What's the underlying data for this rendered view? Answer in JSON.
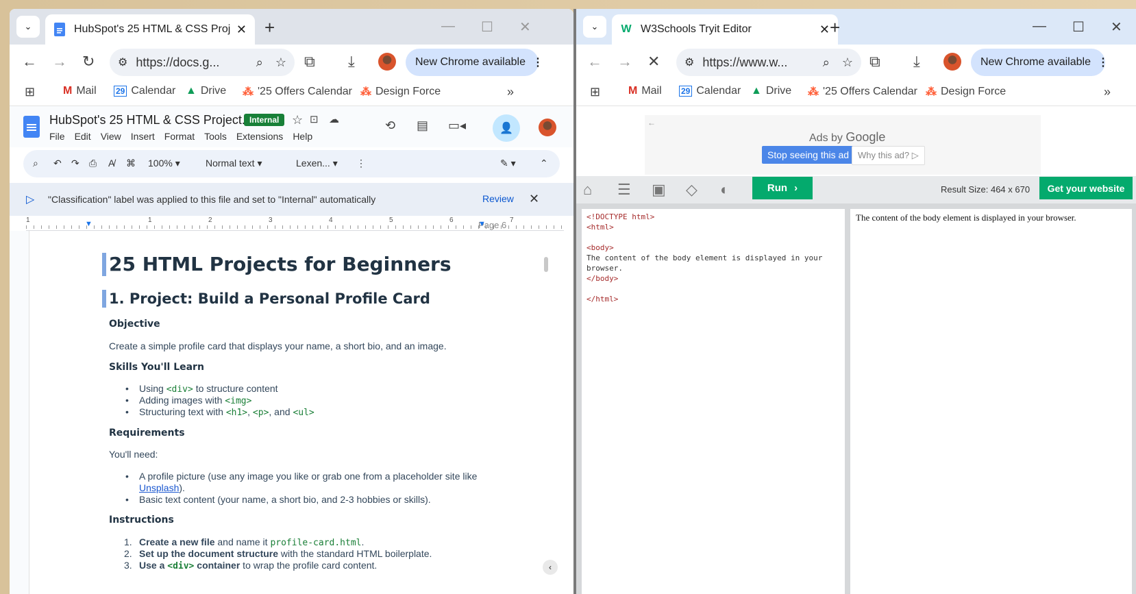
{
  "left_window": {
    "tab_title": "HubSpot's 25 HTML & CSS Proj",
    "url": "https://docs.g...",
    "new_chrome": "New Chrome available",
    "bookmarks": [
      "Mail",
      "Calendar",
      "Drive",
      "'25 Offers Calendar",
      "Design Force"
    ],
    "docs": {
      "title": "HubSpot's 25 HTML & CSS Project...",
      "badge": "Internal",
      "menu": [
        "File",
        "Edit",
        "View",
        "Insert",
        "Format",
        "Tools",
        "Extensions",
        "Help"
      ],
      "zoom": "100%",
      "style": "Normal text",
      "font": "Lexen...",
      "info_message": "\"Classification\" label was applied to this file and set to \"Internal\" automatically",
      "review": "Review",
      "page_label": "Page 6",
      "ruler_numbers": [
        "1",
        "1",
        "2",
        "3",
        "4",
        "5",
        "6",
        "7"
      ],
      "content": {
        "h1": "25 HTML Projects for Beginners",
        "h2": "1. Project: Build a Personal Profile Card",
        "objective_heading": "Objective",
        "objective_text": "Create a simple profile card that displays your name, a short bio, and an image.",
        "skills_heading": "Skills You'll Learn",
        "skill1_pre": "Using ",
        "skill1_code": "<div>",
        "skill1_post": " to structure content",
        "skill2_pre": "Adding images with ",
        "skill2_code": "<img>",
        "skill3_pre": "Structuring text with ",
        "skill3_code1": "<h1>",
        "skill3_sep1": ", ",
        "skill3_code2": "<p>",
        "skill3_sep2": ", and ",
        "skill3_code3": "<ul>",
        "req_heading": "Requirements",
        "req_text": "You'll need:",
        "req1_line1": "A profile picture (use any image you like or grab one from a placeholder site like",
        "req1_link": "Unsplash",
        "req1_end": ").",
        "req2": "Basic text content (your name, a short bio, and 2-3 hobbies or skills).",
        "instr_heading": "Instructions",
        "step1_num": "1.",
        "step1_bold": "Create a new file",
        "step1_text": " and name it ",
        "step1_code": "profile-card.html",
        "step1_end": ".",
        "step2_num": "2.",
        "step2_bold": "Set up the document structure",
        "step2_text": " with the standard HTML boilerplate.",
        "step3_num": "3.",
        "step3_bold_pre": "Use a ",
        "step3_code": "<div>",
        "step3_bold_post": " container",
        "step3_text": " to wrap the profile card content."
      }
    }
  },
  "right_window": {
    "tab_title": "W3Schools Tryit Editor",
    "url": "https://www.w...",
    "new_chrome": "New Chrome available",
    "bookmarks": [
      "Mail",
      "Calendar",
      "Drive",
      "'25 Offers Calendar",
      "Design Force"
    ],
    "ad": {
      "ads_by": "Ads by",
      "google": "Google",
      "stop": "Stop seeing this ad",
      "why": "Why this ad? ▷"
    },
    "run": "Run",
    "result_size": "Result Size: 464 x 670",
    "get_website": "Get your website",
    "code_lines": [
      "<!DOCTYPE html>",
      "<html>",
      "",
      "<body>",
      "The content of the body element is displayed in your",
      "browser.",
      "</body>",
      "",
      "</html>"
    ],
    "result_text": "The content of the body element is displayed in your browser."
  },
  "colors": {
    "w3_green": "#04aa6d",
    "docs_blue": "#4285f4",
    "internal_green": "#188038",
    "heading_navy": "#213343"
  },
  "icons": [
    "chevron-down-icon",
    "docs-favicon",
    "w3-favicon",
    "close-icon",
    "plus-icon",
    "minimize-icon",
    "maximize-icon",
    "back-icon",
    "forward-icon",
    "reload-icon",
    "stop-icon",
    "tune-icon",
    "zoom-icon",
    "star-icon",
    "extensions-icon",
    "download-icon",
    "more-icon",
    "apps-icon",
    "home-icon",
    "menu-icon",
    "save-icon",
    "rotate-icon",
    "contrast-icon"
  ]
}
